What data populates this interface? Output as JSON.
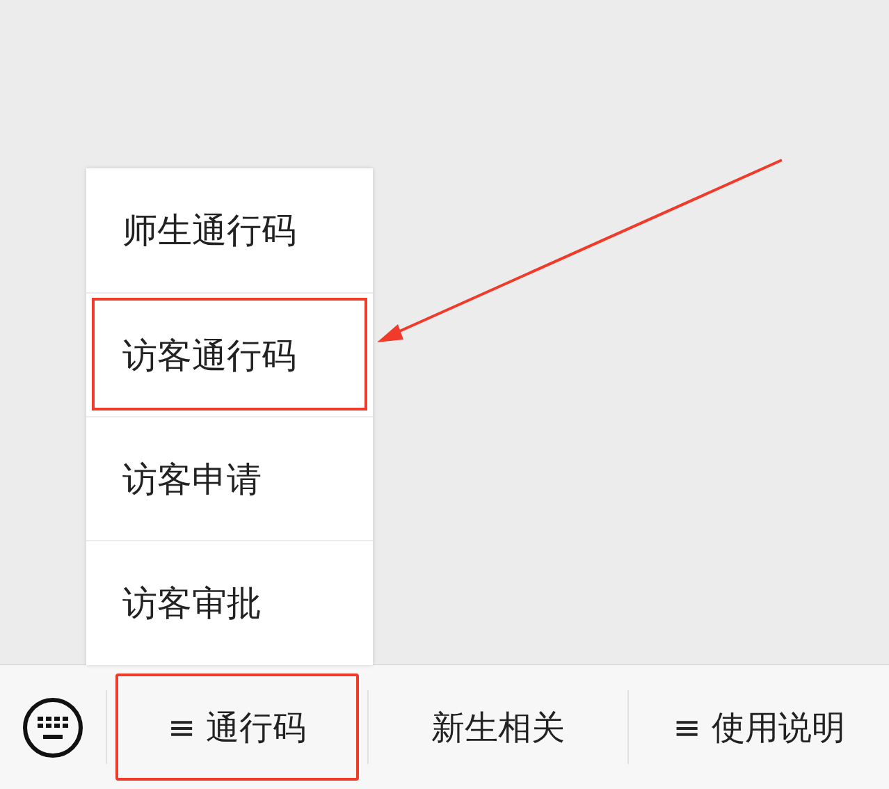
{
  "menu": {
    "items": [
      {
        "label": "师生通行码",
        "highlighted": false
      },
      {
        "label": "访客通行码",
        "highlighted": true
      },
      {
        "label": "访客申请",
        "highlighted": false
      },
      {
        "label": "访客审批",
        "highlighted": false
      }
    ]
  },
  "bottom_bar": {
    "tabs": [
      {
        "label": "≡ 通行码",
        "highlighted": true
      },
      {
        "label": "新生相关",
        "highlighted": false
      },
      {
        "label": "≡ 使用说明",
        "highlighted": false
      }
    ]
  }
}
